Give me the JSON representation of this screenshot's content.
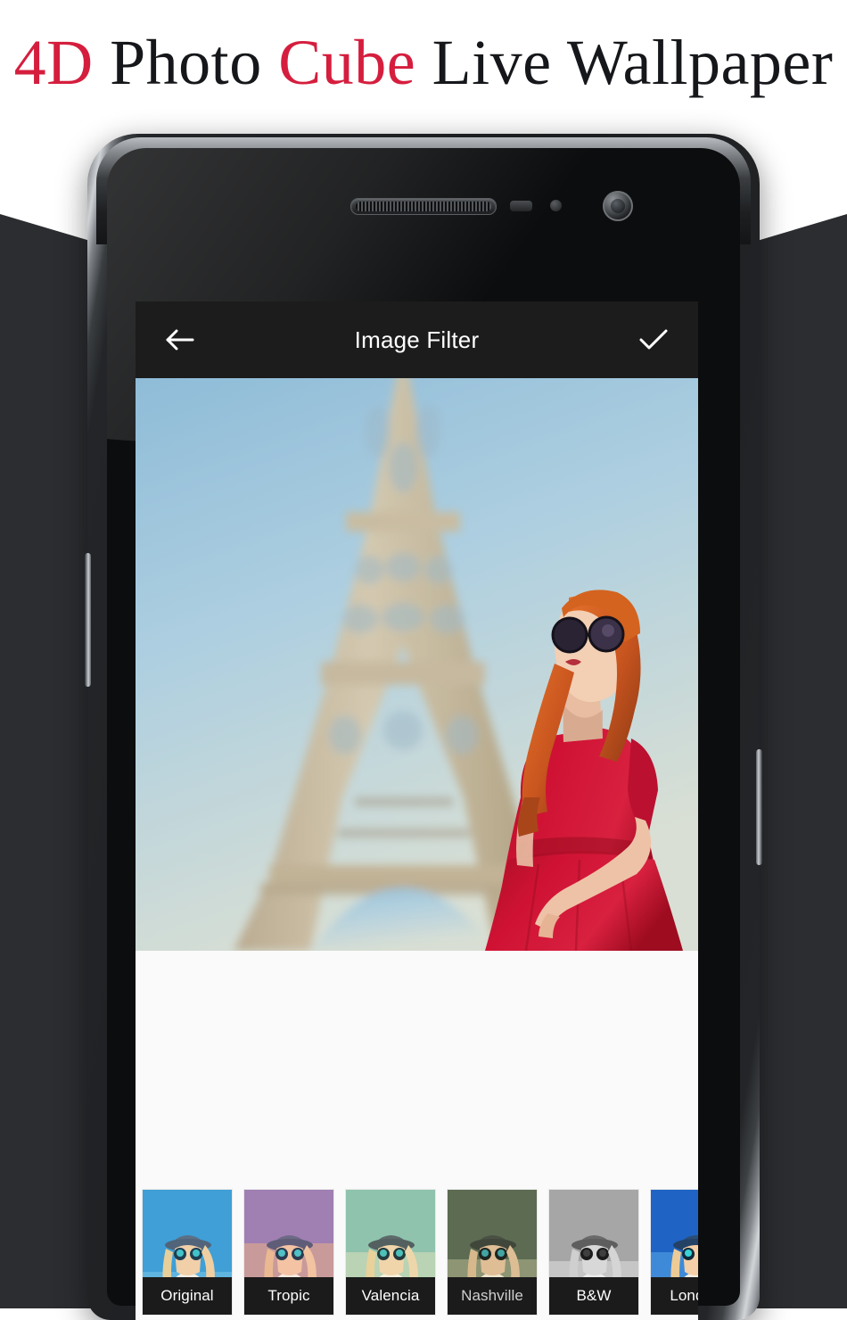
{
  "banner": {
    "title_parts": [
      {
        "text": "4D",
        "color": "accent"
      },
      {
        "text": " Photo ",
        "color": "dark"
      },
      {
        "text": "Cube",
        "color": "accent"
      },
      {
        "text": " Live Wallpaper",
        "color": "dark"
      }
    ],
    "full_title": "4D Photo Cube Live Wallpaper",
    "accent_color": "#d51e3e",
    "dark_color": "#15171a",
    "background_color": "#ffffff"
  },
  "backdrop": {
    "color": "#2b2d30"
  },
  "device": {
    "frame_color": "#1b1d1f",
    "icons": {
      "speaker": "speaker-grille",
      "proximity_sensor": "proximity-sensor",
      "light_sensor": "light-sensor",
      "front_camera": "front-camera",
      "volume_button": "volume-button",
      "power_button": "power-button"
    }
  },
  "app": {
    "appbar": {
      "back_icon": "back-arrow-icon",
      "title": "Image Filter",
      "confirm_icon": "check-icon",
      "background_color": "#1c1c1c",
      "text_color": "#ffffff"
    },
    "preview": {
      "alt": "Woman in red dress with sunglasses in front of the Eiffel Tower",
      "background_color": "#fafafa"
    },
    "filters": [
      {
        "name": "Original",
        "selected": true,
        "dim_label": false
      },
      {
        "name": "Tropic",
        "selected": false,
        "dim_label": false
      },
      {
        "name": "Valencia",
        "selected": false,
        "dim_label": false
      },
      {
        "name": "Nashville",
        "selected": false,
        "dim_label": true
      },
      {
        "name": "B&W",
        "selected": false,
        "dim_label": false
      },
      {
        "name": "London",
        "selected": false,
        "dim_label": false
      }
    ]
  }
}
